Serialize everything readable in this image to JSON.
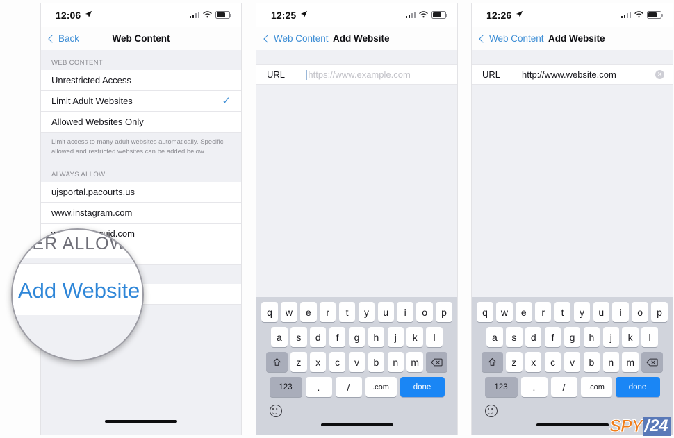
{
  "panels": [
    {
      "id": "web-content-settings",
      "status": {
        "time": "12:06",
        "location_icon": "location-arrow-icon",
        "signal_icon": "cellular-signal-icon",
        "wifi_icon": "wifi-icon",
        "battery_icon": "battery-icon"
      },
      "nav": {
        "back_label": "Back",
        "title": "Web Content"
      },
      "section1_header": "WEB CONTENT",
      "options": [
        {
          "label": "Unrestricted Access",
          "checked": false
        },
        {
          "label": "Limit Adult Websites",
          "checked": true
        },
        {
          "label": "Allowed Websites Only",
          "checked": false
        }
      ],
      "footnote": "Limit access to many adult websites automatically. Specific allowed and restricted websites can be added below.",
      "section2_header": "ALWAYS ALLOW:",
      "allowed_sites": [
        "ujsportal.pacourts.us",
        "www.instagram.com",
        "www.turbosquid.com"
      ],
      "add_website_allow": "Add Website",
      "section3_header": "NEVER ALLOW:",
      "add_website_never": "Add Website"
    },
    {
      "id": "add-website-empty",
      "status": {
        "time": "12:25",
        "location_icon": "location-arrow-icon",
        "signal_icon": "cellular-signal-icon",
        "wifi_icon": "wifi-icon",
        "battery_icon": "battery-icon"
      },
      "nav": {
        "back_label": "Web Content",
        "title": "Add Website"
      },
      "url_label": "URL",
      "url_value": "",
      "url_placeholder": "https://www.example.com",
      "has_clear": false
    },
    {
      "id": "add-website-filled",
      "status": {
        "time": "12:26",
        "location_icon": "location-arrow-icon",
        "signal_icon": "cellular-signal-icon",
        "wifi_icon": "wifi-icon",
        "battery_icon": "battery-icon"
      },
      "nav": {
        "back_label": "Web Content",
        "title": "Add Website"
      },
      "url_label": "URL",
      "url_value": "http://www.website.com",
      "url_placeholder": "https://www.example.com",
      "has_clear": true,
      "clear_icon": "clear-text-icon"
    }
  ],
  "magnifier": {
    "section_label": "NEVER ALLOW:",
    "zoomed_label": "Add Website"
  },
  "keyboard": {
    "row1": [
      "q",
      "w",
      "e",
      "r",
      "t",
      "y",
      "u",
      "i",
      "o",
      "p"
    ],
    "row2": [
      "a",
      "s",
      "d",
      "f",
      "g",
      "h",
      "j",
      "k",
      "l"
    ],
    "row3": [
      "z",
      "x",
      "c",
      "v",
      "b",
      "n",
      "m"
    ],
    "shift_icon": "shift-icon",
    "backspace_icon": "backspace-icon",
    "numbers_key": "123",
    "period_key": ".",
    "slash_key": "/",
    "dotcom_key": ".com",
    "done_key": "done",
    "emoji_icon": "emoji-smiley-icon"
  },
  "watermark": {
    "brand": "SPY",
    "slash": "/",
    "number": "24"
  },
  "colors": {
    "accent_blue": "#3c8dd5",
    "link_blue": "#2e86d8",
    "done_blue": "#1a86f5",
    "list_bg": "#eff0f4",
    "keyboard_bg": "#d1d4dc",
    "logo_orange": "#f07d1a",
    "logo_blue": "#5a79b8"
  }
}
